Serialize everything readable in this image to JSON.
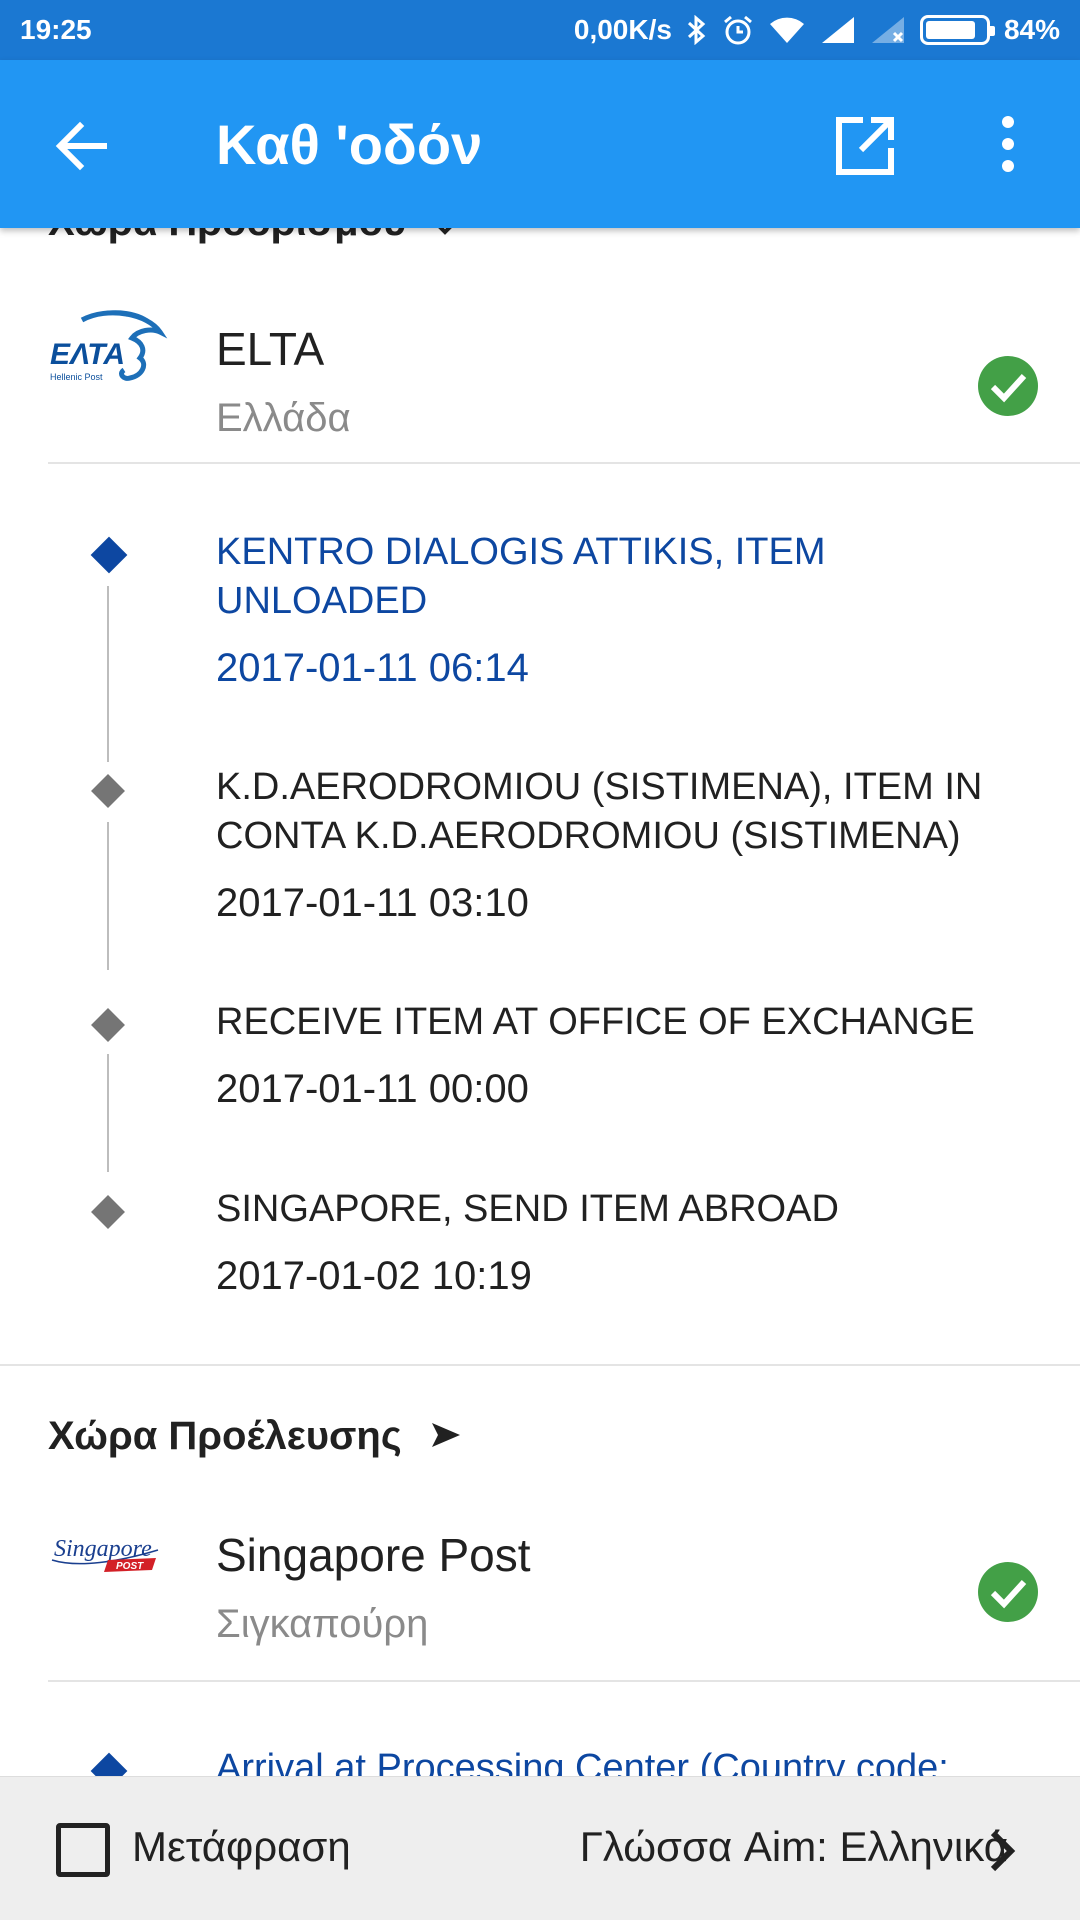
{
  "status_bar": {
    "time": "19:25",
    "net_speed": "0,00K/s",
    "battery": "84%",
    "battery_level": 0.84,
    "icons": [
      "bluetooth-icon",
      "alarm-icon",
      "wifi-icon",
      "signal-icon",
      "signal-no-sim-icon",
      "battery-icon"
    ]
  },
  "app_bar": {
    "title": "Καθ 'οδόν",
    "back_icon": "arrow-left-icon",
    "open_icon": "open-in-new-icon",
    "more_icon": "more-vert-icon"
  },
  "colors": {
    "status_bar": "#1b78d2",
    "app_bar": "#2196f3",
    "latest_event": "#0d47a1",
    "check_green": "#43a047",
    "secondary_text": "#8a8a8a"
  },
  "destination": {
    "header": "Χώρα Προορισμού",
    "carrier_name": "ELTA",
    "country": "Ελλάδα",
    "logo_text": "ΕΛΤΑ",
    "logo_sub": "Hellenic Post",
    "events": [
      {
        "desc": "KENTRO DIALOGIS ATTIKIS, ITEM UNLOADED",
        "date": "2017-01-11 06:14"
      },
      {
        "desc": "K.D.AERODROMIOU (SISTIMENA), ITEM IN CONTA K.D.AERODROMIOU (SISTIMENA)",
        "date": "2017-01-11 03:10"
      },
      {
        "desc": "RECEIVE ITEM AT OFFICE OF EXCHANGE",
        "date": "2017-01-11 00:00"
      },
      {
        "desc": "SINGAPORE, SEND ITEM ABROAD",
        "date": "2017-01-02 10:19"
      }
    ]
  },
  "origin": {
    "header": "Χώρα Προέλευσης",
    "carrier_name": "Singapore Post",
    "country": "Σιγκαπούρη",
    "logo_text": "Singapore",
    "logo_sub": "POST",
    "events": [
      {
        "desc": "Arrival at Processing Center (Country code:"
      }
    ]
  },
  "bottom_bar": {
    "translate_label": "Μετάφραση",
    "translate_checked": false,
    "language_label": "Γλώσσα Aim: Ελληνικά"
  }
}
